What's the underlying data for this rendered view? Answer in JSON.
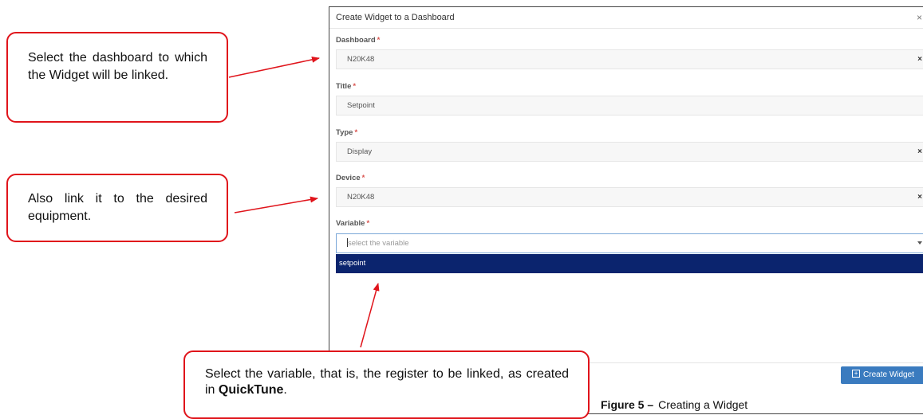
{
  "modal": {
    "title": "Create Widget to a Dashboard",
    "close_glyph": "×",
    "required_mark": "*",
    "fields": {
      "dashboard": {
        "label": "Dashboard",
        "value": "N20K48",
        "clear_glyph": "×"
      },
      "title": {
        "label": "Title",
        "value": "Setpoint"
      },
      "type": {
        "label": "Type",
        "value": "Display",
        "clear_glyph": "×"
      },
      "device": {
        "label": "Device",
        "value": "N20K48",
        "clear_glyph": "×"
      },
      "variable": {
        "label": "Variable",
        "placeholder": "select the variable",
        "option": "setpoint"
      }
    },
    "create_button": {
      "icon": "plus-square-icon",
      "label": "Create Widget"
    }
  },
  "callouts": {
    "dashboard": "Select the dashboard to which the Widget will be linked.",
    "device": "Also link it to the desired equipment.",
    "variable_prefix": "Select the variable, that is, the register to be linked, as created in ",
    "variable_bold": "QuickTune",
    "variable_suffix": "."
  },
  "caption": {
    "number": "Figure 5 –",
    "text": "Creating a Widget"
  },
  "colors": {
    "accent_red": "#e0141b",
    "button_blue": "#3a7bbf",
    "option_highlight": "#0b246e"
  }
}
